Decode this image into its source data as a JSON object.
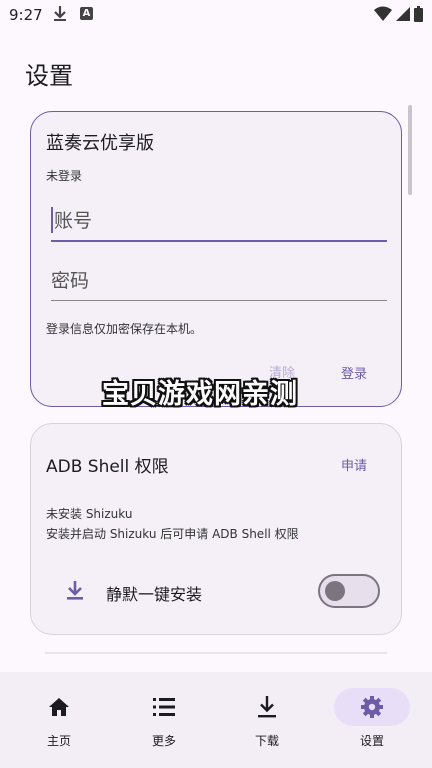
{
  "status_bar": {
    "time": "9:27",
    "badge": "A"
  },
  "page": {
    "title": "设置"
  },
  "lanzou": {
    "title": "蓝奏云优享版",
    "status": "未登录",
    "account_label": "账号",
    "password_label": "密码",
    "note": "登录信息仅加密保存在本机。",
    "clear_label": "清除",
    "login_label": "登录"
  },
  "watermark": "宝贝游戏网亲测",
  "adb": {
    "title": "ADB Shell 权限",
    "apply_label": "申请",
    "status": "未安装 Shizuku",
    "description": "安装并启动 Shizuku 后可申请 ADB Shell 权限",
    "silent_install_label": "静默一键安装",
    "silent_install_enabled": false
  },
  "bottom_nav": {
    "items": [
      {
        "label": "主页",
        "icon": "home-icon"
      },
      {
        "label": "更多",
        "icon": "list-icon"
      },
      {
        "label": "下载",
        "icon": "download-icon"
      },
      {
        "label": "设置",
        "icon": "gear-icon",
        "selected": true
      }
    ]
  },
  "colors": {
    "accent": "#6d5ca6",
    "selected_pill": "#e8def8",
    "surface": "#f5eff8"
  }
}
